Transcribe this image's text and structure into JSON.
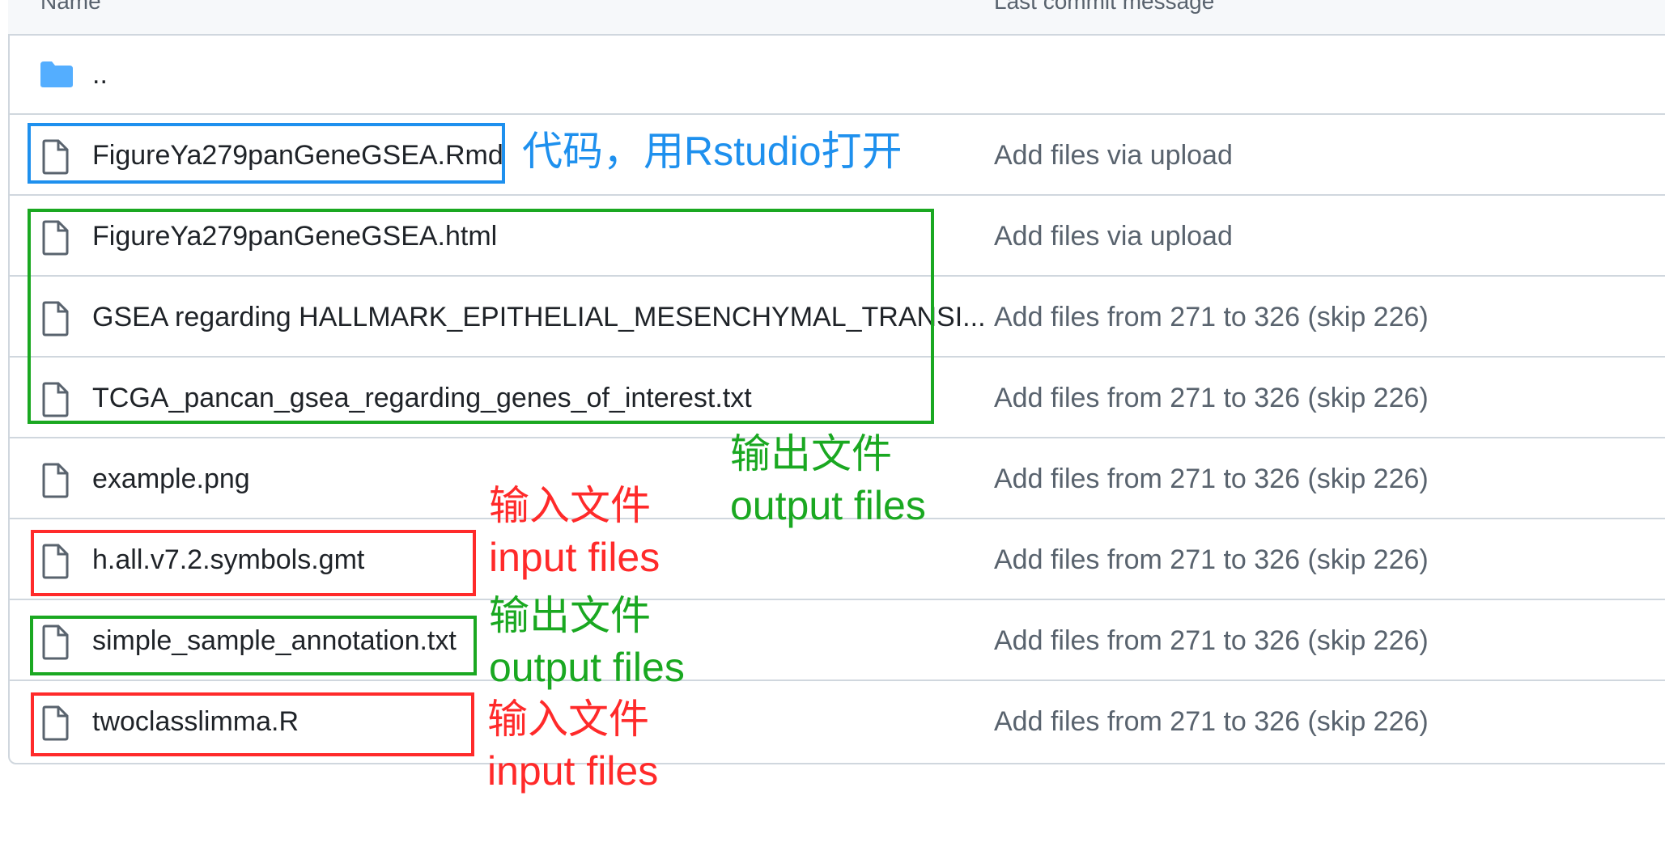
{
  "header": {
    "name_col": "Name",
    "commit_col": "Last commit message"
  },
  "rows": [
    {
      "name": "..",
      "commit": "",
      "icon": "folder-icon"
    },
    {
      "name": "FigureYa279panGeneGSEA.Rmd",
      "commit": "Add files via upload",
      "icon": "file-icon"
    },
    {
      "name": "FigureYa279panGeneGSEA.html",
      "commit": "Add files via upload",
      "icon": "file-icon"
    },
    {
      "name": "GSEA regarding HALLMARK_EPITHELIAL_MESENCHYMAL_TRANSI...",
      "commit": "Add files from 271 to 326 (skip 226)",
      "icon": "file-icon"
    },
    {
      "name": "TCGA_pancan_gsea_regarding_genes_of_interest.txt",
      "commit": "Add files from 271 to 326 (skip 226)",
      "icon": "file-icon"
    },
    {
      "name": "example.png",
      "commit": "Add files from 271 to 326 (skip 226)",
      "icon": "file-icon"
    },
    {
      "name": "h.all.v7.2.symbols.gmt",
      "commit": "Add files from 271 to 326 (skip 226)",
      "icon": "file-icon"
    },
    {
      "name": "simple_sample_annotation.txt",
      "commit": "Add files from 271 to 326 (skip 226)",
      "icon": "file-icon"
    },
    {
      "name": "twoclasslimma.R",
      "commit": "Add files from 271 to 326 (skip 226)",
      "icon": "file-icon"
    }
  ],
  "annotations": {
    "code": "代码，用Rstudio打开",
    "output_cn": "输出文件",
    "output_en": "output files",
    "input_cn": "输入文件",
    "input_en": "input files"
  },
  "colors": {
    "code_annotation": "#1e90ee",
    "output_annotation": "#1aa821",
    "input_annotation": "#ff2a2a",
    "folder_icon": "#54aeff",
    "file_icon": "#59636e",
    "border": "#d0d7de"
  }
}
